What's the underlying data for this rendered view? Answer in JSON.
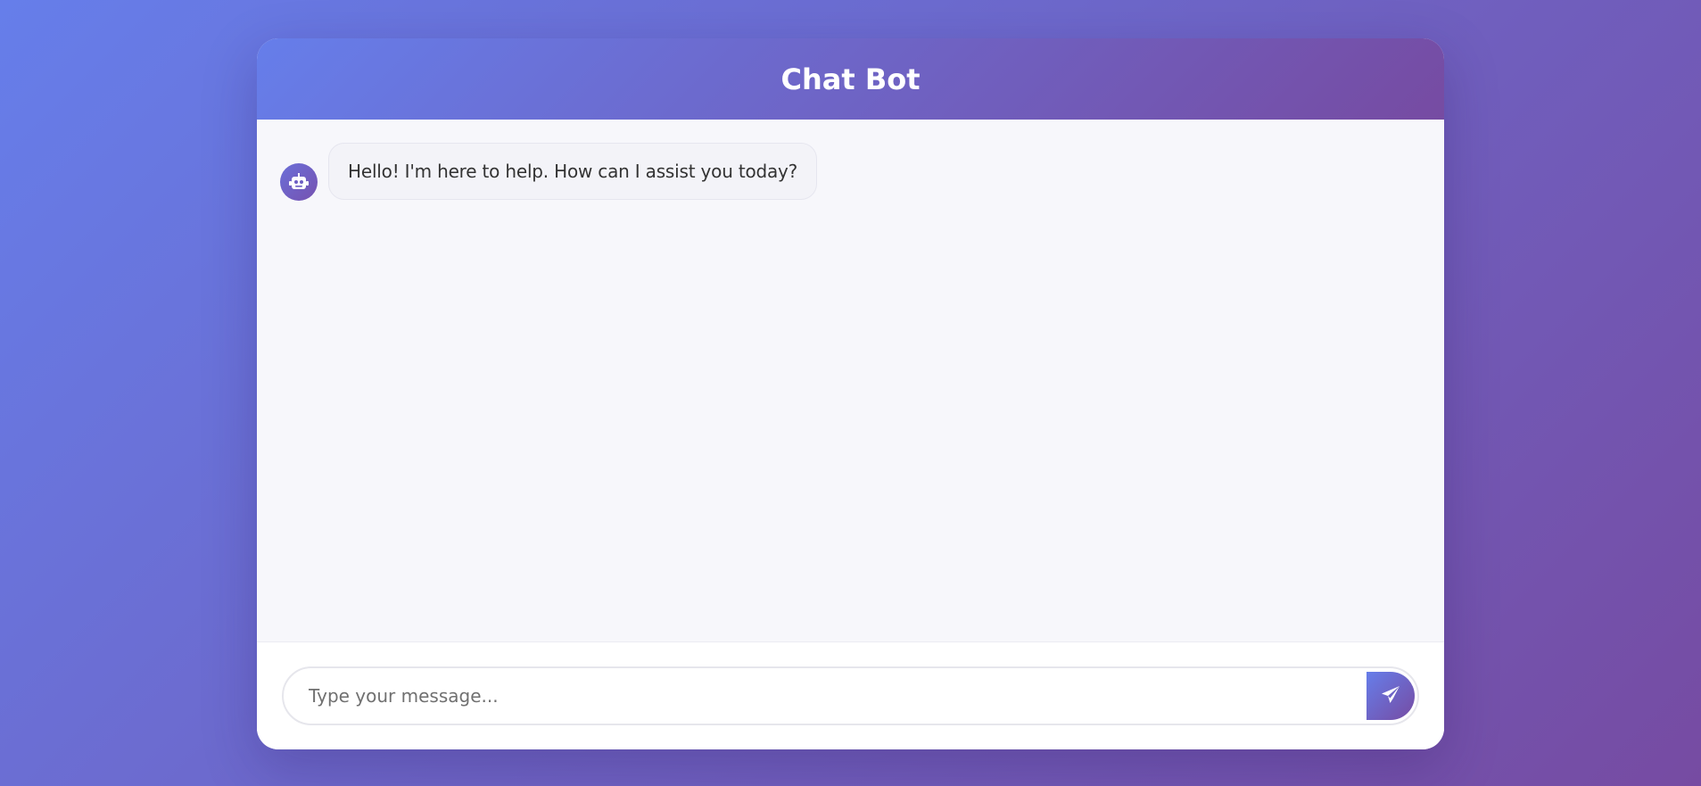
{
  "header": {
    "title": "Chat Bot"
  },
  "messages": [
    {
      "sender": "bot",
      "avatar_icon": "robot-icon",
      "text": "Hello! I'm here to help. How can I assist you today?"
    }
  ],
  "composer": {
    "placeholder": "Type your message...",
    "value": "",
    "send_icon": "paper-plane-icon"
  },
  "colors": {
    "gradient_start": "#667eea",
    "gradient_end": "#764ba2",
    "messages_background": "#f7f7fb",
    "bubble_background": "#f3f3f8",
    "text": "#333333"
  }
}
